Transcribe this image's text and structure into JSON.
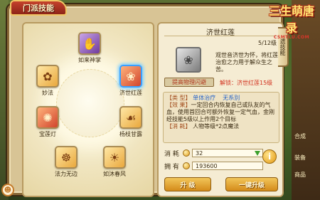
{
  "window_title": "门派技能",
  "logo": {
    "main": "三生萌唐录",
    "sub": "CSMTLU.COM"
  },
  "skills": [
    {
      "label": "如来神掌",
      "icon": "palm-icon",
      "style": "purple"
    },
    {
      "label": "妙法",
      "icon": "lotus-icon",
      "style": "gold"
    },
    {
      "label": "济世红莲",
      "icon": "red-lotus-icon",
      "style": "red"
    },
    {
      "label": "宝莲灯",
      "icon": "lantern-icon",
      "style": "red"
    },
    {
      "label": "杨枝甘露",
      "icon": "willow-icon",
      "style": "gold"
    },
    {
      "label": "法力无边",
      "icon": "buddha-icon",
      "style": "gold"
    },
    {
      "label": "如沐春风",
      "icon": "breeze-icon",
      "style": "gold"
    }
  ],
  "detail": {
    "name": "济世红莲",
    "level": "5/12级",
    "description": "观世音济世为怀，将红莲治愈之力用于解众生之苦。",
    "improve_button": "提高物理闪避",
    "unlock_text": "解锁：济世红莲15级",
    "type_tag": "【类  型】",
    "type_value": "单体治疗",
    "element_value": "无系别",
    "effect_tag": "【效  果】",
    "effect_text": "一定回合内恢复自己或队友的气血，使用首回合可额外恢复一定气血，金刚经技能5级以上作用2个目标",
    "consume_tag": "【消  耗】",
    "consume_text": "人物等级*2点魔法"
  },
  "cost": {
    "label": "消  耗",
    "value": "32"
  },
  "have": {
    "label": "拥  有",
    "value": "193600"
  },
  "buttons": {
    "upgrade": "升  级",
    "one_click": "一键升级"
  },
  "side_tab": "遗技能",
  "side_labels": [
    "合成",
    "装备",
    "商品"
  ]
}
